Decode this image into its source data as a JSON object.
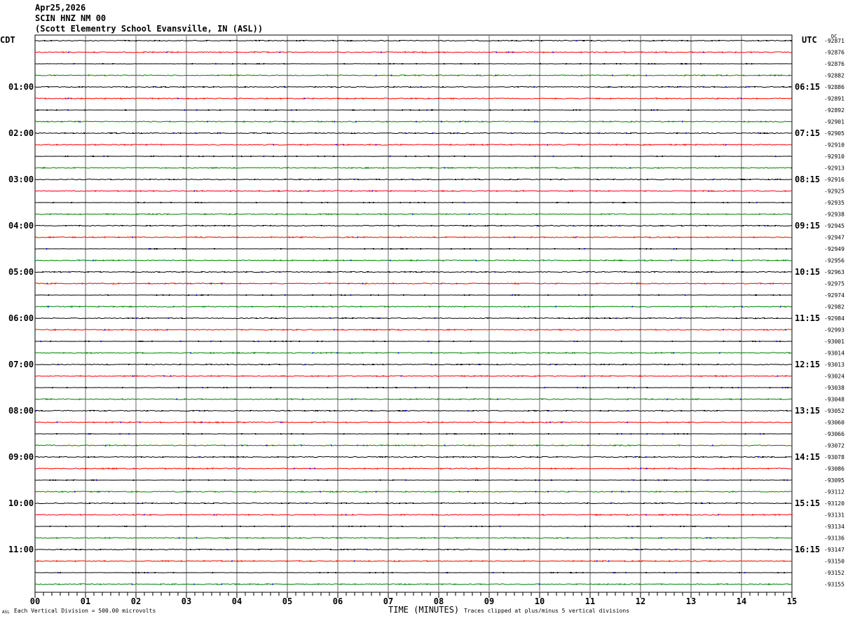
{
  "header": {
    "date": "Apr25,2026",
    "station": "SCIN HNZ NM 00",
    "location": "(Scott Elementry School Evansville, IN (ASL))"
  },
  "chart_data": {
    "type": "line",
    "title": "",
    "left_timezone": "CDT",
    "right_timezone": "UTC",
    "dc_label": "DC",
    "xlabel": "TIME (MINUTES)",
    "xlim": [
      0,
      15
    ],
    "x_tick_labels": [
      "00",
      "01",
      "02",
      "03",
      "04",
      "05",
      "06",
      "07",
      "08",
      "09",
      "10",
      "11",
      "12",
      "13",
      "14",
      "15"
    ],
    "traces_per_hour": 4,
    "trace_colors": [
      "#000000",
      "#ff0000",
      "#0000ff",
      "#008000"
    ],
    "grid": true,
    "left_hour_labels": [
      "01:00",
      "02:00",
      "03:00",
      "04:00",
      "05:00",
      "06:00",
      "07:00",
      "08:00",
      "09:00",
      "10:00",
      "11:00"
    ],
    "right_hour_labels": [
      "06:15",
      "07:15",
      "08:15",
      "09:15",
      "10:15",
      "11:15",
      "12:15",
      "13:15",
      "14:15",
      "15:15",
      "16:15"
    ],
    "dc_offsets": [
      -92871,
      -92876,
      -92876,
      -92882,
      -92886,
      -92891,
      -92892,
      -92901,
      -92905,
      -92910,
      -92910,
      -92913,
      -92916,
      -92925,
      -92935,
      -92938,
      -92945,
      -92947,
      -92949,
      -92956,
      -92963,
      -92975,
      -92974,
      -92982,
      -92984,
      -92993,
      -93001,
      -93014,
      -93013,
      -93024,
      -93038,
      -93048,
      -93052,
      -93060,
      -93066,
      -93072,
      -93078,
      -93086,
      -93095,
      -93112,
      -93120,
      -93131,
      -93134,
      -93136,
      -93147,
      -93150,
      -93152,
      -93155
    ]
  },
  "footer": {
    "scale_note": "Each Vertical Division =  500.00 microvolts",
    "clip_note": "Traces clipped at plus/minus 5 vertical divisions",
    "corner_mark": "ASL"
  }
}
